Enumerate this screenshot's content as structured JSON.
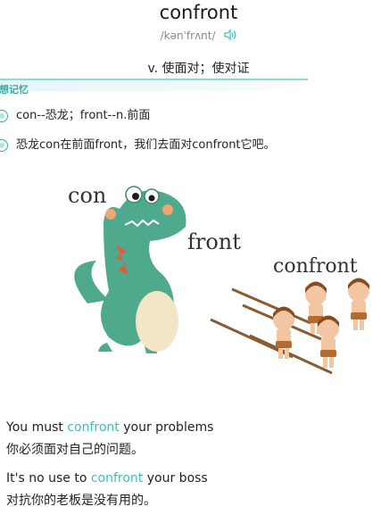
{
  "word": "confront",
  "phonetic": "/kənˈfrʌnt/",
  "definition": "v. 使面对；使对证",
  "memory_tag": "联想记忆",
  "memory_lines": [
    "con--恐龙；front--n.前面",
    "恐龙con在前面front，我们去面对confront它吧。"
  ],
  "illustration": {
    "label_con": "con",
    "label_front": "front",
    "label_confront": "confront"
  },
  "examples": [
    {
      "before": "You must ",
      "highlight": "confront",
      "after": " your problems",
      "zh": "你必须面对自己的问题。"
    },
    {
      "before": "It's no use to ",
      "highlight": "confront",
      "after": " your boss",
      "zh": "对抗你的老板是没有用的。"
    }
  ],
  "colors": {
    "accent": "#3fbdbd",
    "dino": "#4fa98c",
    "belly": "#f3e6c6",
    "skin": "#f2c6a0",
    "hair": "#8a4a22"
  }
}
